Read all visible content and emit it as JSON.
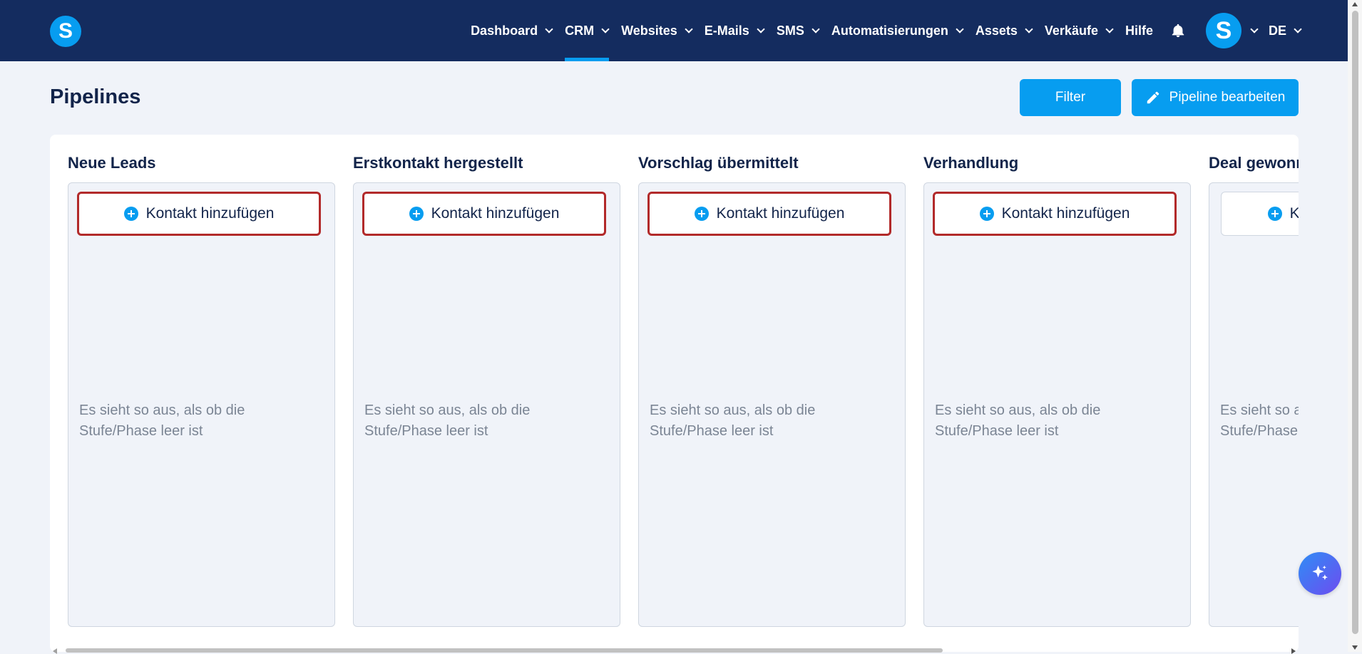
{
  "app": {
    "logo_letter": "S",
    "avatar_letter": "S",
    "accent_color": "#079df0",
    "nav_bg_color": "#142c5f",
    "highlight_border_color": "#b22a2a"
  },
  "nav": {
    "items": [
      {
        "label": "Dashboard",
        "dropdown": true
      },
      {
        "label": "CRM",
        "dropdown": true,
        "active": true
      },
      {
        "label": "Websites",
        "dropdown": true
      },
      {
        "label": "E-Mails",
        "dropdown": true
      },
      {
        "label": "SMS",
        "dropdown": true
      },
      {
        "label": "Automatisierungen",
        "dropdown": true
      },
      {
        "label": "Assets",
        "dropdown": true
      },
      {
        "label": "Verkäufe",
        "dropdown": true
      },
      {
        "label": "Hilfe",
        "dropdown": false
      }
    ],
    "language": "DE",
    "icons": [
      "bell-icon",
      "chevron-down-icon"
    ]
  },
  "page": {
    "title": "Pipelines",
    "filter_label": "Filter",
    "edit_label": "Pipeline bearbeiten"
  },
  "columns": [
    {
      "title": "Neue Leads",
      "add_label": "Kontakt hinzufügen",
      "empty_text": "Es sieht so aus, als ob die Stufe/Phase leer ist"
    },
    {
      "title": "Erstkontakt hergestellt",
      "add_label": "Kontakt hinzufügen",
      "empty_text": "Es sieht so aus, als ob die Stufe/Phase leer ist"
    },
    {
      "title": "Vorschlag übermittelt",
      "add_label": "Kontakt hinzufügen",
      "empty_text": "Es sieht so aus, als ob die Stufe/Phase leer ist"
    },
    {
      "title": "Verhandlung",
      "add_label": "Kontakt hinzufügen",
      "empty_text": "Es sieht so aus, als ob die Stufe/Phase leer ist"
    },
    {
      "title": "Deal gewonnen",
      "add_label": "Kontakt hinzufügen",
      "empty_text": "Es sieht so aus, als ob die Stufe/Phase leer ist"
    }
  ]
}
